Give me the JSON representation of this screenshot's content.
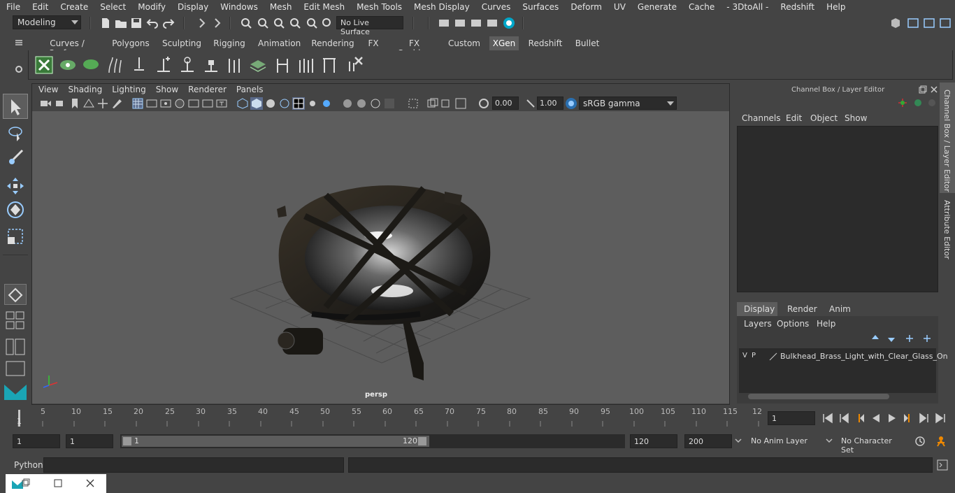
{
  "menubar": [
    "File",
    "Edit",
    "Create",
    "Select",
    "Modify",
    "Display",
    "Windows",
    "Mesh",
    "Edit Mesh",
    "Mesh Tools",
    "Mesh Display",
    "Curves",
    "Surfaces",
    "Deform",
    "UV",
    "Generate",
    "Cache",
    "- 3DtoAll -",
    "Redshift",
    "Help"
  ],
  "status": {
    "mode": "Modeling",
    "live_surface": "No Live Surface"
  },
  "shelf_tabs": [
    {
      "label": "Curves / Surfaces",
      "active": false
    },
    {
      "label": "Polygons",
      "active": false
    },
    {
      "label": "Sculpting",
      "active": false
    },
    {
      "label": "Rigging",
      "active": false
    },
    {
      "label": "Animation",
      "active": false
    },
    {
      "label": "Rendering",
      "active": false
    },
    {
      "label": "FX",
      "active": false
    },
    {
      "label": "FX Caching",
      "active": false
    },
    {
      "label": "Custom",
      "active": false
    },
    {
      "label": "XGen",
      "active": true
    },
    {
      "label": "Redshift",
      "active": false
    },
    {
      "label": "Bullet",
      "active": false
    }
  ],
  "viewport_menu": [
    "View",
    "Shading",
    "Lighting",
    "Show",
    "Renderer",
    "Panels"
  ],
  "viewport": {
    "exposure": "0.00",
    "gamma": "1.00",
    "color_space": "sRGB gamma",
    "camera_label": "persp"
  },
  "right_panel": {
    "title": "Channel Box / Layer Editor",
    "channel_menu": [
      "Channels",
      "Edit",
      "Object",
      "Show"
    ],
    "layer_tabs": [
      "Display",
      "Render",
      "Anim"
    ],
    "active_layer_tab": "Display",
    "layer_menu": [
      "Layers",
      "Options",
      "Help"
    ],
    "layer": {
      "v": "V",
      "p": "P",
      "name": "Bulkhead_Brass_Light_with_Clear_Glass_On"
    },
    "side_tabs": [
      "Channel Box / Layer Editor",
      "Attribute Editor"
    ]
  },
  "timeline": {
    "ticks": [
      "5",
      "10",
      "15",
      "20",
      "25",
      "30",
      "35",
      "40",
      "45",
      "50",
      "55",
      "60",
      "65",
      "70",
      "75",
      "80",
      "85",
      "90",
      "95",
      "100",
      "105",
      "110",
      "115",
      "12"
    ],
    "start_tick": "1",
    "current_frame": "1"
  },
  "range": {
    "start": "1",
    "anim_start": "1",
    "slider_min": "1",
    "slider_max": "120",
    "end": "120",
    "anim_end": "200",
    "anim_layer": "No Anim Layer",
    "char_set": "No Character Set"
  },
  "cmdline": {
    "label": "Python"
  },
  "colors": {
    "bg": "#444444",
    "viewport": "#5d5d5d",
    "field": "#2b2b2b",
    "active_tab": "#5d5d5d",
    "accent": "#00a6c8"
  }
}
